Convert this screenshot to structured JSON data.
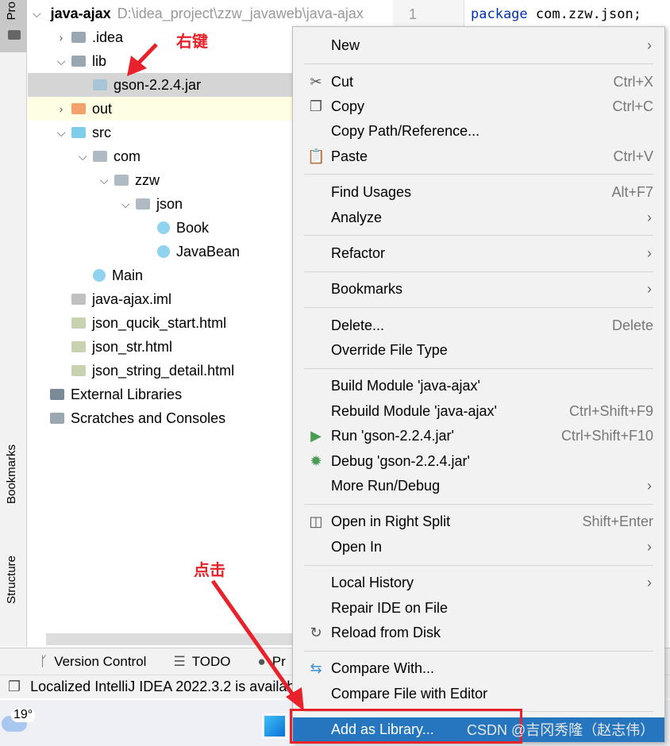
{
  "sidebar": {
    "project_tab": "Pro",
    "bookmarks_tab": "Bookmarks",
    "structure_tab": "Structure"
  },
  "tree": [
    {
      "label": "java-ajax",
      "path": "D:\\idea_project\\zzw_javaweb\\java-ajax",
      "indent": 0,
      "chev": "v",
      "icon": "module-folder-icon",
      "bold": true
    },
    {
      "label": ".idea",
      "indent": 1,
      "chev": ">",
      "icon": "folder-icon"
    },
    {
      "label": "lib",
      "indent": 1,
      "chev": "v",
      "icon": "folder-icon"
    },
    {
      "label": "gson-2.2.4.jar",
      "indent": 2,
      "chev": "",
      "icon": "jar-icon",
      "selected": true
    },
    {
      "label": "out",
      "indent": 1,
      "chev": ">",
      "icon": "folder-orange-icon",
      "out": true
    },
    {
      "label": "src",
      "indent": 1,
      "chev": "v",
      "icon": "folder-blue-icon"
    },
    {
      "label": "com",
      "indent": 2,
      "chev": "v",
      "icon": "package-icon"
    },
    {
      "label": "zzw",
      "indent": 3,
      "chev": "v",
      "icon": "package-icon"
    },
    {
      "label": "json",
      "indent": 4,
      "chev": "v",
      "icon": "package-icon"
    },
    {
      "label": "Book",
      "indent": 5,
      "chev": "",
      "icon": "class-icon"
    },
    {
      "label": "JavaBean",
      "indent": 5,
      "chev": "",
      "icon": "class-run-icon"
    },
    {
      "label": "Main",
      "indent": 2,
      "chev": "",
      "icon": "class-run-icon"
    },
    {
      "label": "java-ajax.iml",
      "indent": 1,
      "chev": "",
      "icon": "iml-file-icon"
    },
    {
      "label": "json_qucik_start.html",
      "indent": 1,
      "chev": "",
      "icon": "html-file-icon"
    },
    {
      "label": "json_str.html",
      "indent": 1,
      "chev": "",
      "icon": "html-file-icon"
    },
    {
      "label": "json_string_detail.html",
      "indent": 1,
      "chev": "",
      "icon": "html-file-icon"
    },
    {
      "label": "External Libraries",
      "indent": 0,
      "chev": "",
      "icon": "libraries-icon"
    },
    {
      "label": "Scratches and Consoles",
      "indent": 0,
      "chev": "",
      "icon": "scratches-icon"
    }
  ],
  "editor": {
    "line_number": "1",
    "code_kw": "package",
    "code_rest": " com.zzw.json;"
  },
  "annotations": {
    "right_click": "右键",
    "click": "点击"
  },
  "menu": [
    {
      "label": "New",
      "sub": true
    },
    {
      "sep": true
    },
    {
      "label": "Cut",
      "icon": "scissors-icon",
      "glyph": "✂",
      "shortcut": "Ctrl+X"
    },
    {
      "label": "Copy",
      "icon": "copy-icon",
      "glyph": "❐",
      "shortcut": "Ctrl+C"
    },
    {
      "label": "Copy Path/Reference..."
    },
    {
      "label": "Paste",
      "icon": "clipboard-icon",
      "glyph": "📋",
      "shortcut": "Ctrl+V"
    },
    {
      "sep": true
    },
    {
      "label": "Find Usages",
      "shortcut": "Alt+F7"
    },
    {
      "label": "Analyze",
      "sub": true
    },
    {
      "sep": true
    },
    {
      "label": "Refactor",
      "sub": true
    },
    {
      "sep": true
    },
    {
      "label": "Bookmarks",
      "sub": true
    },
    {
      "sep": true
    },
    {
      "label": "Delete...",
      "shortcut": "Delete"
    },
    {
      "label": "Override File Type"
    },
    {
      "sep": true
    },
    {
      "label": "Build Module 'java-ajax'"
    },
    {
      "label": "Rebuild Module 'java-ajax'",
      "shortcut": "Ctrl+Shift+F9"
    },
    {
      "label": "Run 'gson-2.2.4.jar'",
      "icon": "run-icon",
      "glyph": "▶",
      "color": "#499c54",
      "shortcut": "Ctrl+Shift+F10"
    },
    {
      "label": "Debug 'gson-2.2.4.jar'",
      "icon": "debug-icon",
      "glyph": "✹",
      "color": "#499c54"
    },
    {
      "label": "More Run/Debug",
      "sub": true
    },
    {
      "sep": true
    },
    {
      "label": "Open in Right Split",
      "icon": "split-icon",
      "glyph": "◫",
      "shortcut": "Shift+Enter"
    },
    {
      "label": "Open In",
      "sub": true
    },
    {
      "sep": true
    },
    {
      "label": "Local History",
      "sub": true
    },
    {
      "label": "Repair IDE on File"
    },
    {
      "label": "Reload from Disk",
      "icon": "reload-icon",
      "glyph": "↻"
    },
    {
      "sep": true
    },
    {
      "label": "Compare With...",
      "icon": "compare-icon",
      "glyph": "⇆",
      "color": "#3d8fd6"
    },
    {
      "label": "Compare File with Editor"
    },
    {
      "sep": true
    },
    {
      "label": "Add as Library...",
      "highlighted": true
    }
  ],
  "bottom_tabs": [
    {
      "label": "Version Control",
      "glyph": "ᚴ"
    },
    {
      "label": "TODO",
      "glyph": "☰"
    },
    {
      "label": "Pr",
      "glyph": "●"
    }
  ],
  "status": {
    "message": "Localized IntelliJ IDEA 2022.3.2 is available"
  },
  "taskbar": {
    "temperature": "19°"
  },
  "watermark": "CSDN @吉冈秀隆（赵志伟）"
}
